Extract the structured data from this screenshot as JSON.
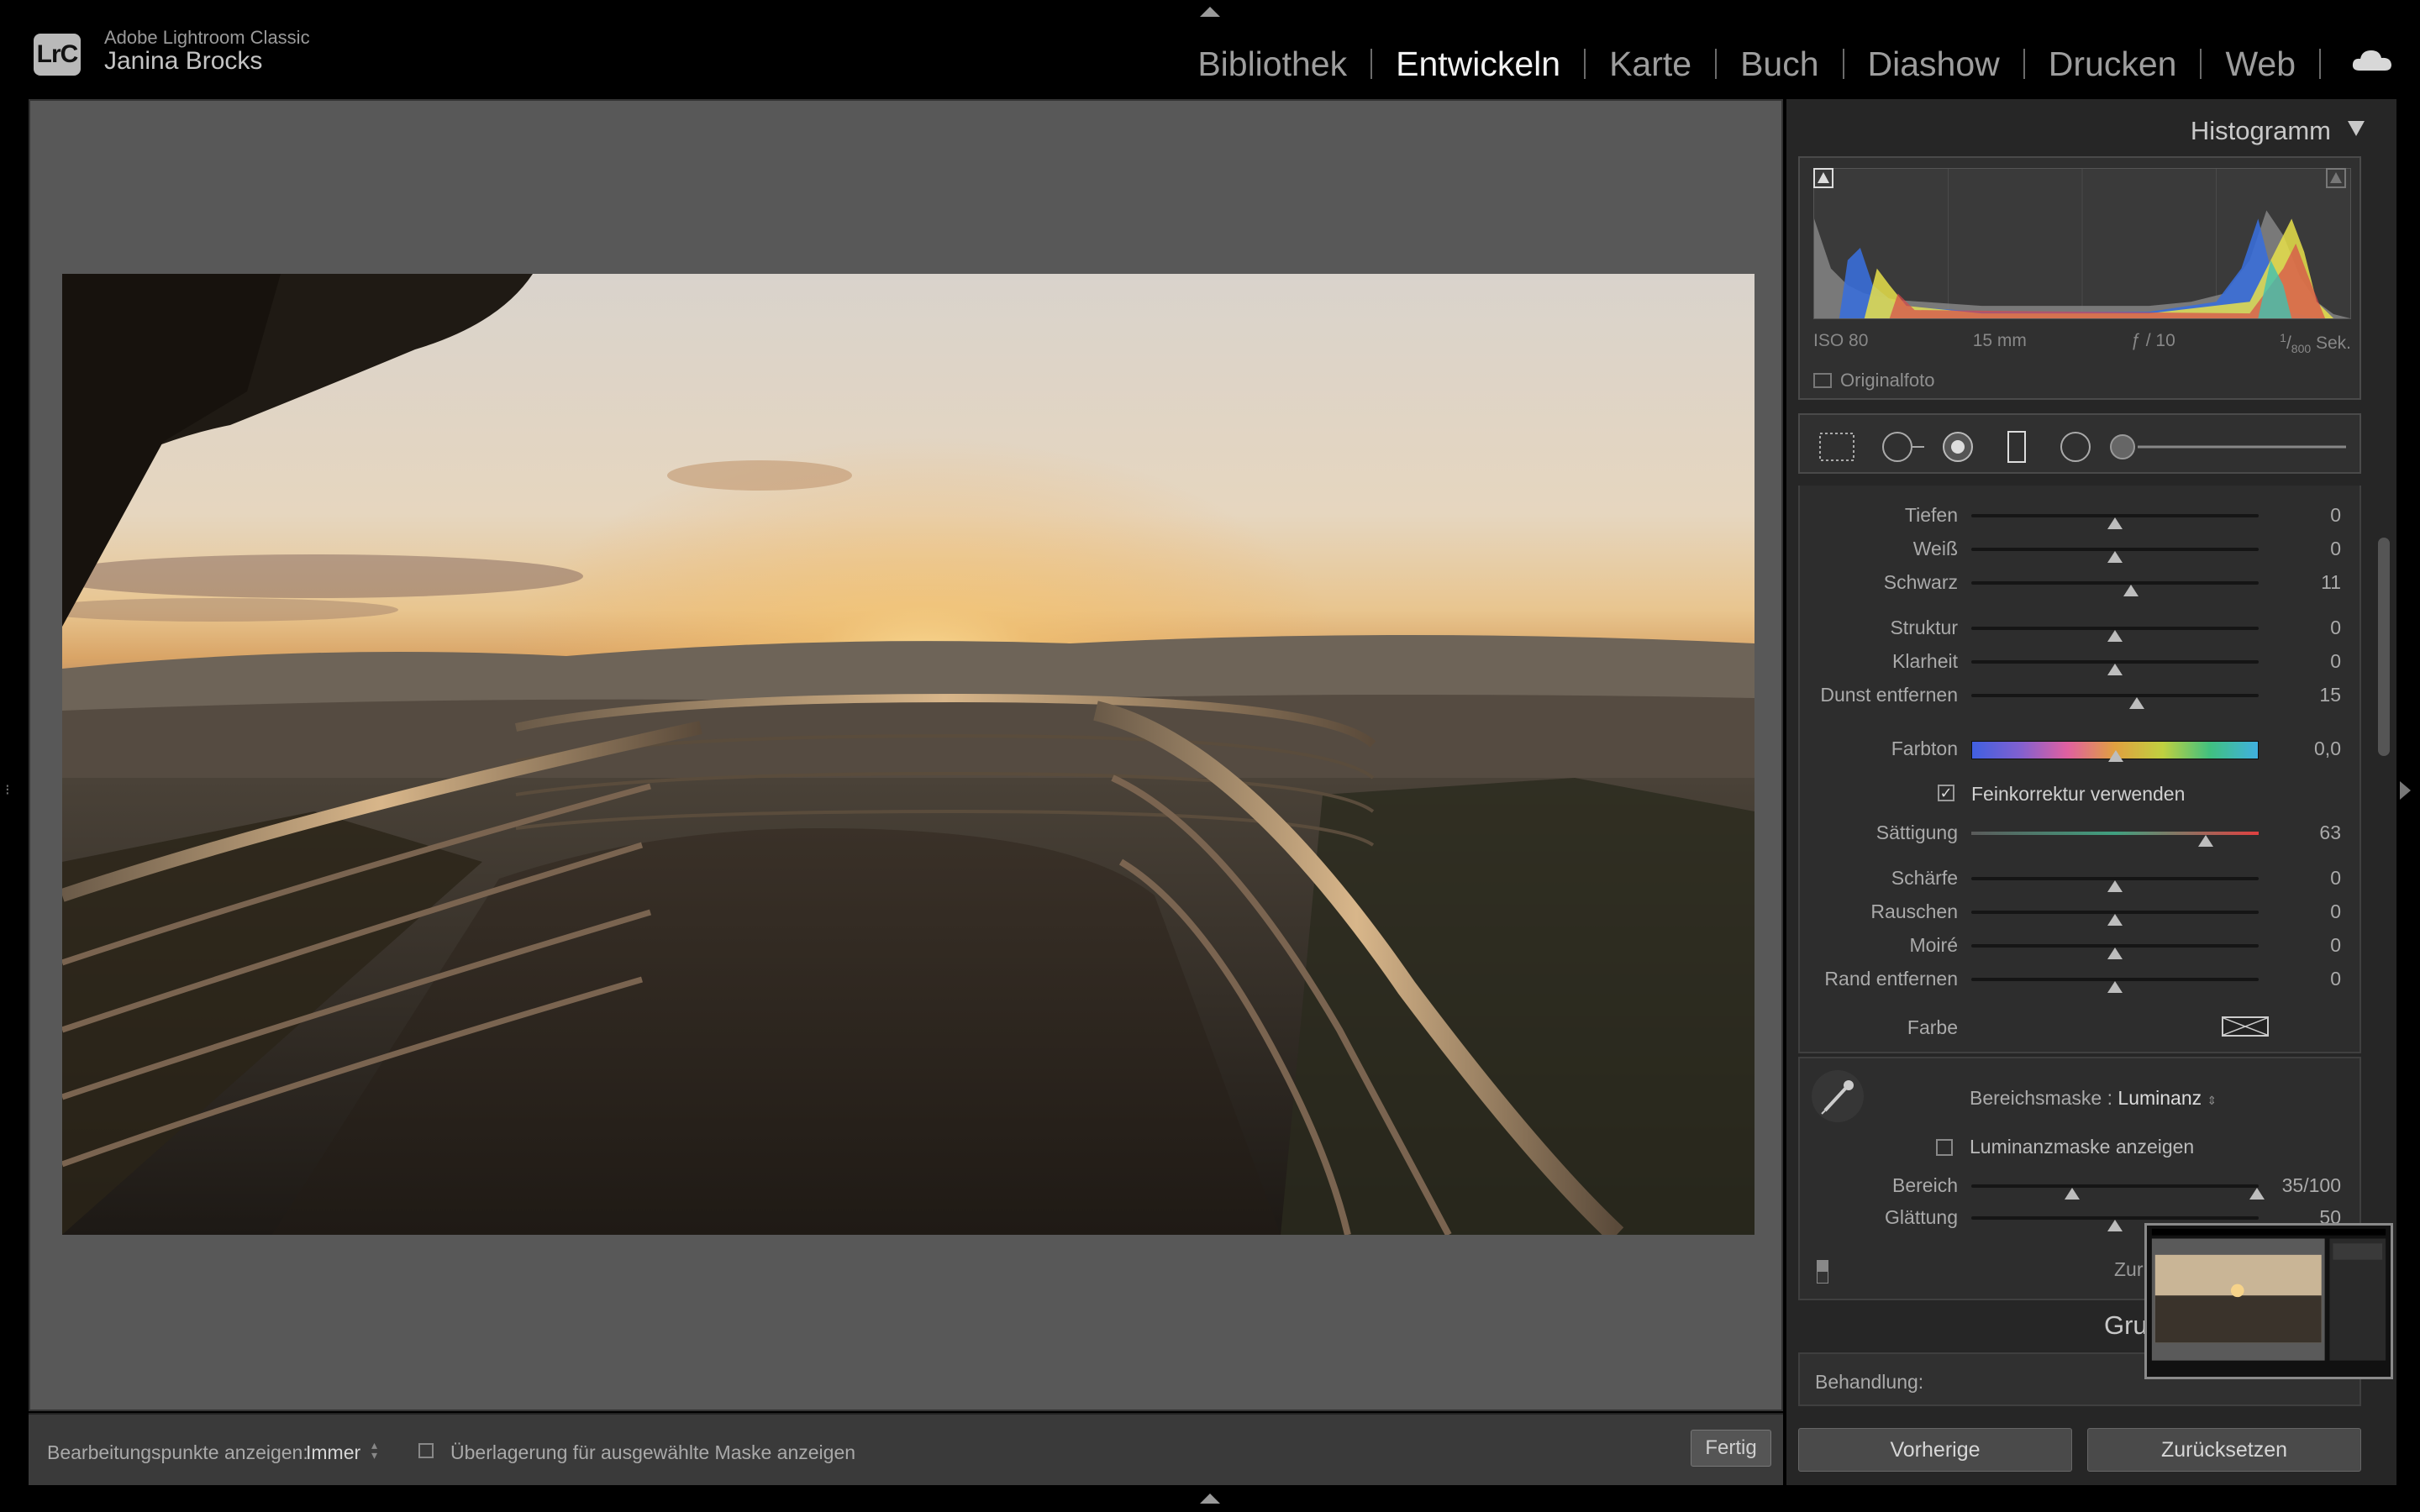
{
  "app": {
    "name": "Adobe Lightroom Classic",
    "user": "Janina Brocks",
    "logo": "LrC"
  },
  "modules": [
    {
      "label": "Bibliothek",
      "active": false
    },
    {
      "label": "Entwickeln",
      "active": true
    },
    {
      "label": "Karte",
      "active": false
    },
    {
      "label": "Buch",
      "active": false
    },
    {
      "label": "Diashow",
      "active": false
    },
    {
      "label": "Drucken",
      "active": false
    },
    {
      "label": "Web",
      "active": false
    }
  ],
  "histogram": {
    "title": "Histogramm",
    "iso": "ISO 80",
    "focal": "15 mm",
    "aperture": "ƒ / 10",
    "shutter_num": "1",
    "shutter_den": "800",
    "shutter_unit": " Sek.",
    "original_label": "Originalfoto"
  },
  "sliders": [
    {
      "label": "Tiefen",
      "value": "0",
      "pos": 0.5
    },
    {
      "label": "Weiß",
      "value": "0",
      "pos": 0.5
    },
    {
      "label": "Schwarz",
      "value": "11",
      "pos": 0.555
    },
    {
      "label": "Struktur",
      "value": "0",
      "pos": 0.5
    },
    {
      "label": "Klarheit",
      "value": "0",
      "pos": 0.5
    },
    {
      "label": "Dunst entfernen",
      "value": "15",
      "pos": 0.575
    },
    {
      "label": "Farbton",
      "value": "0,0",
      "pos": 0.5
    },
    {
      "label": "Sättigung",
      "value": "63",
      "pos": 0.815
    },
    {
      "label": "Schärfe",
      "value": "0",
      "pos": 0.5
    },
    {
      "label": "Rauschen",
      "value": "0",
      "pos": 0.5
    },
    {
      "label": "Moiré",
      "value": "0",
      "pos": 0.5
    },
    {
      "label": "Rand entfernen",
      "value": "0",
      "pos": 0.5
    }
  ],
  "fine_tune": {
    "label": "Feinkorrektur verwenden",
    "checked": true
  },
  "farbe_label": "Farbe",
  "mask": {
    "label_prefix": "Bereichsmaske : ",
    "label_value": "Luminanz",
    "show_mask_label": "Luminanzmaske anzeigen",
    "range_label": "Bereich",
    "range_value": "35/100",
    "range_low": 0.35,
    "range_high": 1.0,
    "smooth_label": "Glättung",
    "smooth_value": "50",
    "smooth_pos": 0.5,
    "reset_partial": "Zur"
  },
  "grund": {
    "title": "Gru",
    "behandlung": "Behandlung:"
  },
  "buttons": {
    "previous": "Vorherige",
    "reset": "Zurücksetzen"
  },
  "toolbar": {
    "edit_points_label": "Bearbeitungspunkte anzeigen:",
    "edit_points_value": "Immer",
    "overlay_label": "Überlagerung für ausgewählte Maske anzeigen",
    "done": "Fertig"
  },
  "colors": {
    "accent": "#f2f2f2",
    "panel": "#2d2d2d",
    "canvas": "#585858"
  }
}
